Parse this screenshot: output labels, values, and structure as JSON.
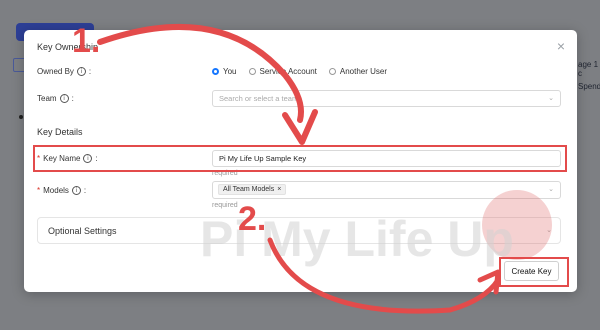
{
  "background": {
    "partial_texts": [
      "age 1 c",
      "Spend"
    ]
  },
  "modal": {
    "close_label": "×",
    "sections": {
      "ownership": "Key Ownership",
      "details": "Key Details"
    },
    "owned_by": {
      "label": "Owned By",
      "options": [
        "You",
        "Service Account",
        "Another User"
      ],
      "selected": "You"
    },
    "team": {
      "label": "Team",
      "placeholder": "Search or select a team"
    },
    "key_name": {
      "label": "Key Name",
      "value": "Pi My Life Up Sample Key",
      "helper": "required"
    },
    "models": {
      "label": "Models",
      "tags": [
        "All Team Models"
      ],
      "helper": "required"
    },
    "optional_settings": "Optional Settings",
    "create_button": "Create Key"
  },
  "annotations": {
    "step1": "1.",
    "step2": "2.",
    "accent_color": "#e34b4b"
  },
  "watermark": "Pi My Life Up"
}
